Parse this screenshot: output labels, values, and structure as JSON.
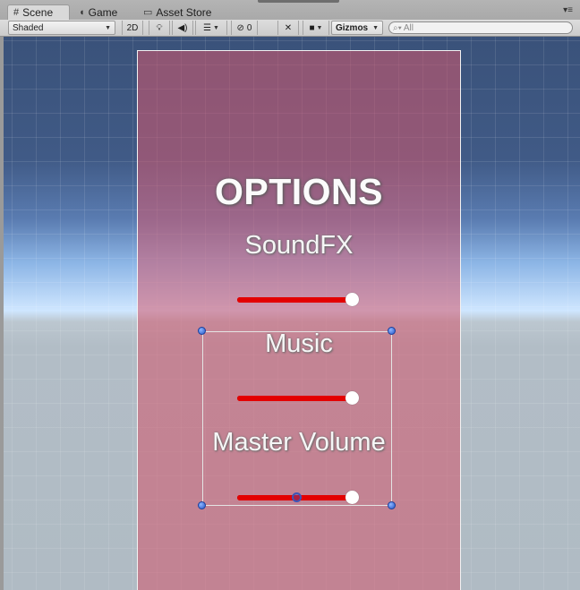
{
  "tabs": [
    {
      "label": "Scene",
      "icon": "grid-icon",
      "active": true
    },
    {
      "label": "Game",
      "icon": "pacman-icon",
      "active": false
    },
    {
      "label": "Asset Store",
      "icon": "bag-icon",
      "active": false
    }
  ],
  "toolbar": {
    "shading": "Shaded",
    "mode_2d": "2D",
    "hidden_count": "0",
    "gizmos": "Gizmos",
    "search_placeholder": "All"
  },
  "scene": {
    "title": "OPTIONS",
    "sections": [
      {
        "label": "SoundFX",
        "slider_value": 1.0
      },
      {
        "label": "Music",
        "slider_value": 1.0
      },
      {
        "label": "Master Volume",
        "slider_value": 1.0
      }
    ]
  },
  "colors": {
    "panel": "#d0586c",
    "slider_fill": "#e30000",
    "handle": "#ffffff",
    "selection_dot": "#2456c8"
  }
}
